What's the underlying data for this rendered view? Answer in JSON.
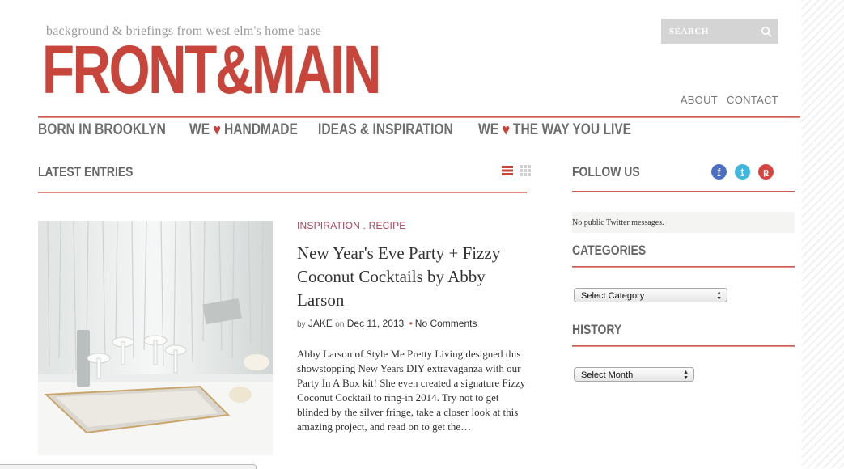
{
  "header": {
    "tagline": "background & briefings from west elm's home base",
    "logo_text": "FRONT&MAIN",
    "search_placeholder": "SEARCH",
    "top_links": [
      "ABOUT",
      "CONTACT"
    ]
  },
  "nav": {
    "items": [
      {
        "label": "BORN IN BROOKLYN"
      },
      {
        "prefix": "WE",
        "heart": "♥",
        "label": "HANDMADE"
      },
      {
        "label": "IDEAS & INSPIRATION"
      },
      {
        "prefix": "WE",
        "heart": "♥",
        "label": "THE WAY YOU LIVE"
      }
    ]
  },
  "main": {
    "section_title": "LATEST ENTRIES",
    "post": {
      "categories": [
        "INSPIRATION",
        "RECIPE"
      ],
      "category_separator": " . ",
      "title": "New Year's Eve Party + Fizzy Coconut Cocktails by Abby Larson",
      "by_label": "by",
      "author": "JAKE",
      "on_label": "on",
      "date": "Dec 11, 2013",
      "comments": "No Comments",
      "excerpt": "Abby Larson of Style Me Pretty Living designed this showstopping New Years DIY extravaganza with our Party In A Box kit! She even created a signature Fizzy Coconut Cocktail to ring-in 2014. Try not to get blinded by the silver fringe, take a closer look at this amazing project, and read on to get the…"
    }
  },
  "sidebar": {
    "follow_title": "FOLLOW US",
    "social_icons": [
      "facebook-icon",
      "twitter-icon",
      "pinterest-icon"
    ],
    "twitter_text": "No public Twitter messages.",
    "categories_title": "CATEGORIES",
    "categories_select": "Select Category",
    "history_title": "HISTORY",
    "history_select": "Select Month"
  },
  "colors": {
    "brand_red": "#c8453b",
    "nav_gray": "#6c6c6c",
    "category_pink": "#b0435b",
    "facebook": "#4a6fc4",
    "twitter": "#41b7e0",
    "pinterest": "#d7443f"
  }
}
